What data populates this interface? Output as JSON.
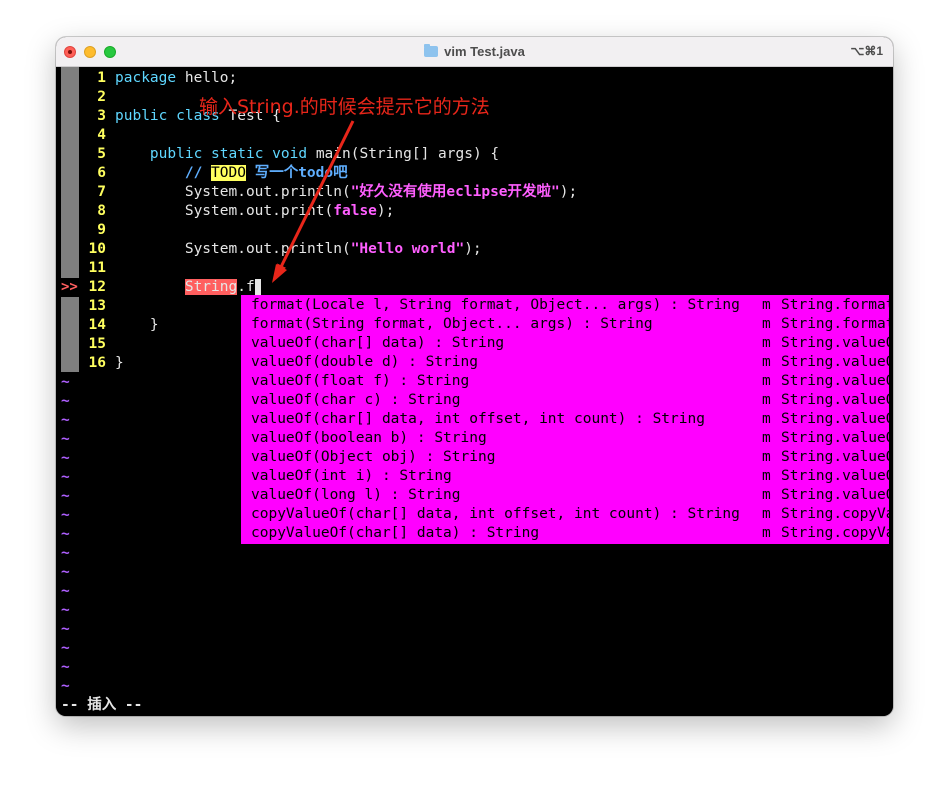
{
  "window": {
    "title": "vim Test.java",
    "shortcut": "⌥⌘1"
  },
  "editor": {
    "lines": [
      {
        "num": "1",
        "parts": [
          {
            "t": "package",
            "c": "kw"
          },
          {
            "t": " hello;",
            "c": ""
          }
        ]
      },
      {
        "num": "2",
        "parts": []
      },
      {
        "num": "3",
        "parts": [
          {
            "t": "public",
            "c": "kw"
          },
          {
            "t": " ",
            "c": ""
          },
          {
            "t": "class",
            "c": "kw"
          },
          {
            "t": " Test {",
            "c": ""
          }
        ]
      },
      {
        "num": "4",
        "parts": []
      },
      {
        "num": "5",
        "parts": [
          {
            "t": "    ",
            "c": ""
          },
          {
            "t": "public",
            "c": "kw"
          },
          {
            "t": " ",
            "c": ""
          },
          {
            "t": "static",
            "c": "kw"
          },
          {
            "t": " ",
            "c": ""
          },
          {
            "t": "void",
            "c": "kw"
          },
          {
            "t": " main(String[] args) {",
            "c": ""
          }
        ]
      },
      {
        "num": "6",
        "parts": [
          {
            "t": "        ",
            "c": ""
          },
          {
            "t": "// ",
            "c": "cm"
          },
          {
            "t": "TODO",
            "c": "todo"
          },
          {
            "t": " 写一个todo吧",
            "c": "cm"
          }
        ]
      },
      {
        "num": "7",
        "parts": [
          {
            "t": "        System.out.println(",
            "c": ""
          },
          {
            "t": "\"好久没有使用eclipse开发啦\"",
            "c": "str"
          },
          {
            "t": ");",
            "c": ""
          }
        ]
      },
      {
        "num": "8",
        "parts": [
          {
            "t": "        System.out.print(",
            "c": ""
          },
          {
            "t": "false",
            "c": "con"
          },
          {
            "t": ");",
            "c": ""
          }
        ]
      },
      {
        "num": "9",
        "parts": []
      },
      {
        "num": "10",
        "parts": [
          {
            "t": "        System.out.println(",
            "c": ""
          },
          {
            "t": "\"Hello world\"",
            "c": "str"
          },
          {
            "t": ");",
            "c": ""
          }
        ]
      },
      {
        "num": "11",
        "parts": []
      },
      {
        "num": "12",
        "parts": [
          {
            "t": "        ",
            "c": ""
          },
          {
            "t": "String",
            "c": "err"
          },
          {
            "t": ".f",
            "c": ""
          }
        ],
        "sign": ">>",
        "cursor": true
      },
      {
        "num": "13",
        "parts": []
      },
      {
        "num": "14",
        "parts": [
          {
            "t": "    }",
            "c": ""
          }
        ]
      },
      {
        "num": "15",
        "parts": []
      },
      {
        "num": "16",
        "parts": [
          {
            "t": "}",
            "c": ""
          }
        ]
      }
    ],
    "tilde": "~",
    "tilde_count": 17,
    "mode_text": "-- 插入 --"
  },
  "completion_popup": {
    "items": [
      {
        "word": "format(Locale l, String format, Object... args) : String",
        "kind": "m",
        "menu": "String.format"
      },
      {
        "word": "format(String format, Object... args) : String",
        "kind": "m",
        "menu": "String.format"
      },
      {
        "word": "valueOf(char[] data) : String",
        "kind": "m",
        "menu": "String.valueOf"
      },
      {
        "word": "valueOf(double d) : String",
        "kind": "m",
        "menu": "String.valueOf"
      },
      {
        "word": "valueOf(float f) : String",
        "kind": "m",
        "menu": "String.valueOf"
      },
      {
        "word": "valueOf(char c) : String",
        "kind": "m",
        "menu": "String.valueOf"
      },
      {
        "word": "valueOf(char[] data, int offset, int count) : String",
        "kind": "m",
        "menu": "String.valueOf"
      },
      {
        "word": "valueOf(boolean b) : String",
        "kind": "m",
        "menu": "String.valueOf"
      },
      {
        "word": "valueOf(Object obj) : String",
        "kind": "m",
        "menu": "String.valueOf"
      },
      {
        "word": "valueOf(int i) : String",
        "kind": "m",
        "menu": "String.valueOf"
      },
      {
        "word": "valueOf(long l) : String",
        "kind": "m",
        "menu": "String.valueOf"
      },
      {
        "word": "copyValueOf(char[] data, int offset, int count) : String",
        "kind": "m",
        "menu": "String.copyValueOf"
      },
      {
        "word": "copyValueOf(char[] data) : String",
        "kind": "m",
        "menu": "String.copyValueOf"
      }
    ]
  },
  "annotation": {
    "text": "输入String.的时候会提示它的方法",
    "color": "#e8261a"
  },
  "colors": {
    "keyword": "#5fd7ff",
    "string": "#ff5fff",
    "line_number": "#ffff5f",
    "popup_bg": "#ff00ff",
    "tilde": "#af5fff"
  }
}
